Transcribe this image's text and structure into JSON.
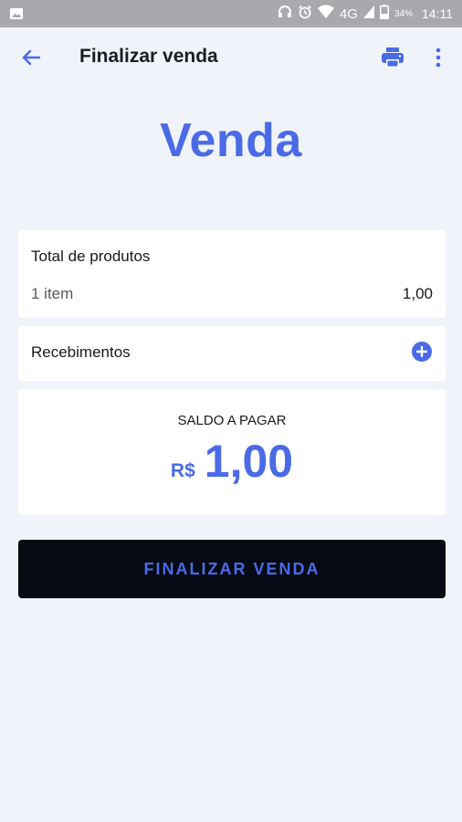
{
  "status_bar": {
    "network": "4G",
    "battery": "34%",
    "time": "14:11"
  },
  "app_bar": {
    "title": "Finalizar venda"
  },
  "hero": {
    "title": "Venda"
  },
  "products": {
    "title": "Total de produtos",
    "count_label": "1 item",
    "total": "1,00"
  },
  "receipts": {
    "label": "Recebimentos"
  },
  "balance": {
    "label": "SALDO A PAGAR",
    "currency": "R$",
    "value": "1,00"
  },
  "actions": {
    "finish_label": "FINALIZAR VENDA"
  },
  "colors": {
    "accent": "#4a6ae6",
    "background": "#f0f3f9",
    "button_bg": "#070a14",
    "status_bar": "#a7a9ad"
  }
}
